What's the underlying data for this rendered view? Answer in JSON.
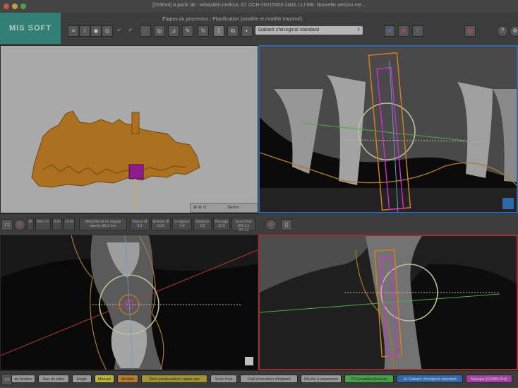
{
  "window": {
    "title": "[253044] A partir de : sebastien.mellout, ID: GCH-20210303-1403, LLl  W8: Nouvelle version me..."
  },
  "toolbar": {
    "logo_text": "MIS SOFT",
    "process_label": "Étapes du processus : Planification (modèle et modèle imprimé)",
    "step_number": "1",
    "guide_select_value": "Gabarit chirurgical standard"
  },
  "panes": {
    "model_3d": {
      "background": "#cfcfcf",
      "zoom_select_value": "Serrer"
    },
    "panoramic": {},
    "axial": {},
    "cross_section": {}
  },
  "midbar": {
    "cells": [
      {
        "label": "36"
      },
      {
        "label": "MIS C1"
      },
      {
        "label": "4.20"
      },
      {
        "label": "13.00"
      },
      {
        "label": "MGUIDE kit for regular sleeve, Ø5.3 mm"
      },
      {
        "label": "Interne Ø\n3.5"
      },
      {
        "label": "Externe Ø\n6.20"
      },
      {
        "label": "Longueur\n4.0"
      },
      {
        "label": "Distance\n3.5"
      },
      {
        "label": "Perçage\n22.0"
      },
      {
        "label": "Scan Post\nMIS C1 SP122"
      }
    ]
  },
  "bottombar": {
    "buttons": [
      {
        "label": "de fixation",
        "color": "#b9b9b9"
      },
      {
        "label": "Axe du pilier",
        "color": "#b9b9b9"
      },
      {
        "label": "Règle",
        "color": "#b9b9b9"
      },
      {
        "label": "Manuel",
        "color": "#e6e04a"
      },
      {
        "label": "Modèle",
        "color": "#e09a3a"
      },
      {
        "label": "Dent (restauration) upper jaw",
        "color": "#c2b640"
      },
      {
        "label": "Scan Post",
        "color": "#b9b9b9"
      },
      {
        "label": "Outil d'insertion d'implant",
        "color": "#b9b9b9"
      },
      {
        "label": "Mèche à expansion",
        "color": "#b9b9b9"
      },
      {
        "label": "STL(modèle)(liaison)",
        "color": "#59c25b"
      },
      {
        "label": "2e Gabarit chirurgical standard",
        "color": "#3f7fd0"
      },
      {
        "label": "Masque (CDAM Pro)",
        "color": "#cc4fcc"
      }
    ]
  },
  "colors": {
    "implant": "#ff38ff",
    "guide_sleeve": "#ff9a2a",
    "bone_outline": "#d2923c",
    "crosshair": "#e8e8b8",
    "axis_line": "#58d358",
    "axial_line": "#d84a3a"
  }
}
